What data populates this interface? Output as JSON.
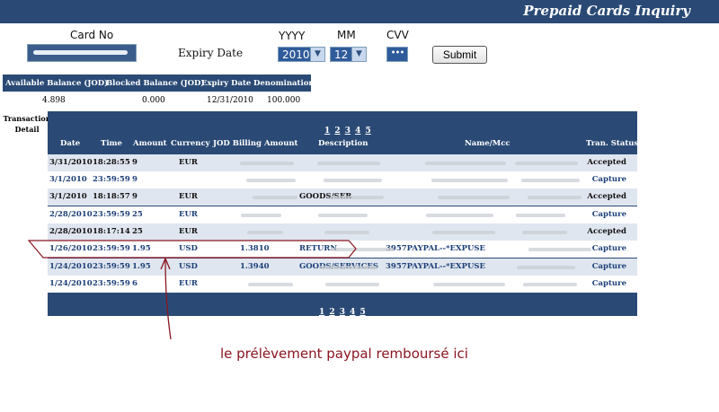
{
  "header": {
    "title": "Prepaid Cards Inquiry"
  },
  "form": {
    "card_no_label": "Card No",
    "expiry_label": "Expiry Date",
    "yyyy_label": "YYYY",
    "mm_label": "MM",
    "cvv_label": "CVV",
    "year_value": "2010",
    "month_value": "12",
    "cvv_value": "•••",
    "submit_label": "Submit"
  },
  "balance": {
    "headers": [
      "Available Balance (JOD)",
      "Blocked Balance (JOD)",
      "Expiry Date",
      "Denomination"
    ],
    "values": [
      "4.898",
      "0.000",
      "12/31/2010",
      "100.000"
    ]
  },
  "transactions": {
    "section_label_1": "Transaction",
    "section_label_2": "Detail",
    "pages": [
      "1",
      "2",
      "3",
      "4",
      "5"
    ],
    "columns": [
      "Date",
      "Time",
      "Amount",
      "Currency",
      "JOD Billing Amount",
      "Description",
      "Name/Mcc",
      "Tran. Status"
    ],
    "rows": [
      {
        "date": "3/31/2010",
        "time": "18:28:55",
        "amount": "9",
        "currency": "EUR",
        "billing": "",
        "description": "",
        "name": "",
        "status": "Accepted"
      },
      {
        "date": "3/1/2010",
        "time": "23:59:59",
        "amount": "9",
        "currency": "",
        "billing": "",
        "description": "",
        "name": "",
        "status": "Capture"
      },
      {
        "date": "3/1/2010",
        "time": "18:18:57",
        "amount": "9",
        "currency": "EUR",
        "billing": "",
        "description": "GOODS/SER",
        "name": "",
        "status": "Accepted"
      },
      {
        "date": "2/28/2010",
        "time": "23:59:59",
        "amount": "25",
        "currency": "EUR",
        "billing": "",
        "description": "",
        "name": "",
        "status": "Capture"
      },
      {
        "date": "2/28/2010",
        "time": "18:17:14",
        "amount": "25",
        "currency": "EUR",
        "billing": "",
        "description": "",
        "name": "",
        "status": "Accepted"
      },
      {
        "date": "1/26/2010",
        "time": "23:59:59",
        "amount": "1.95",
        "currency": "USD",
        "billing": "1.3810",
        "description": "RETURN",
        "name": "3957PAYPAL--*EXPUSE",
        "status": "Capture"
      },
      {
        "date": "1/24/2010",
        "time": "23:59:59",
        "amount": "1.95",
        "currency": "USD",
        "billing": "1.3940",
        "description": "GOODS/SERVICES",
        "name": "3957PAYPAL--*EXPUSE",
        "status": "Capture"
      },
      {
        "date": "1/24/2010",
        "time": "23:59:59",
        "amount": "6",
        "currency": "EUR",
        "billing": "",
        "description": "",
        "name": "",
        "status": "Capture"
      }
    ]
  },
  "annotation": {
    "text": "le prélèvement paypal remboursé ici"
  },
  "colors": {
    "header_bg": "#2a4a75",
    "annotation": "#8a1520",
    "row_alt": "#dfe6ef"
  }
}
